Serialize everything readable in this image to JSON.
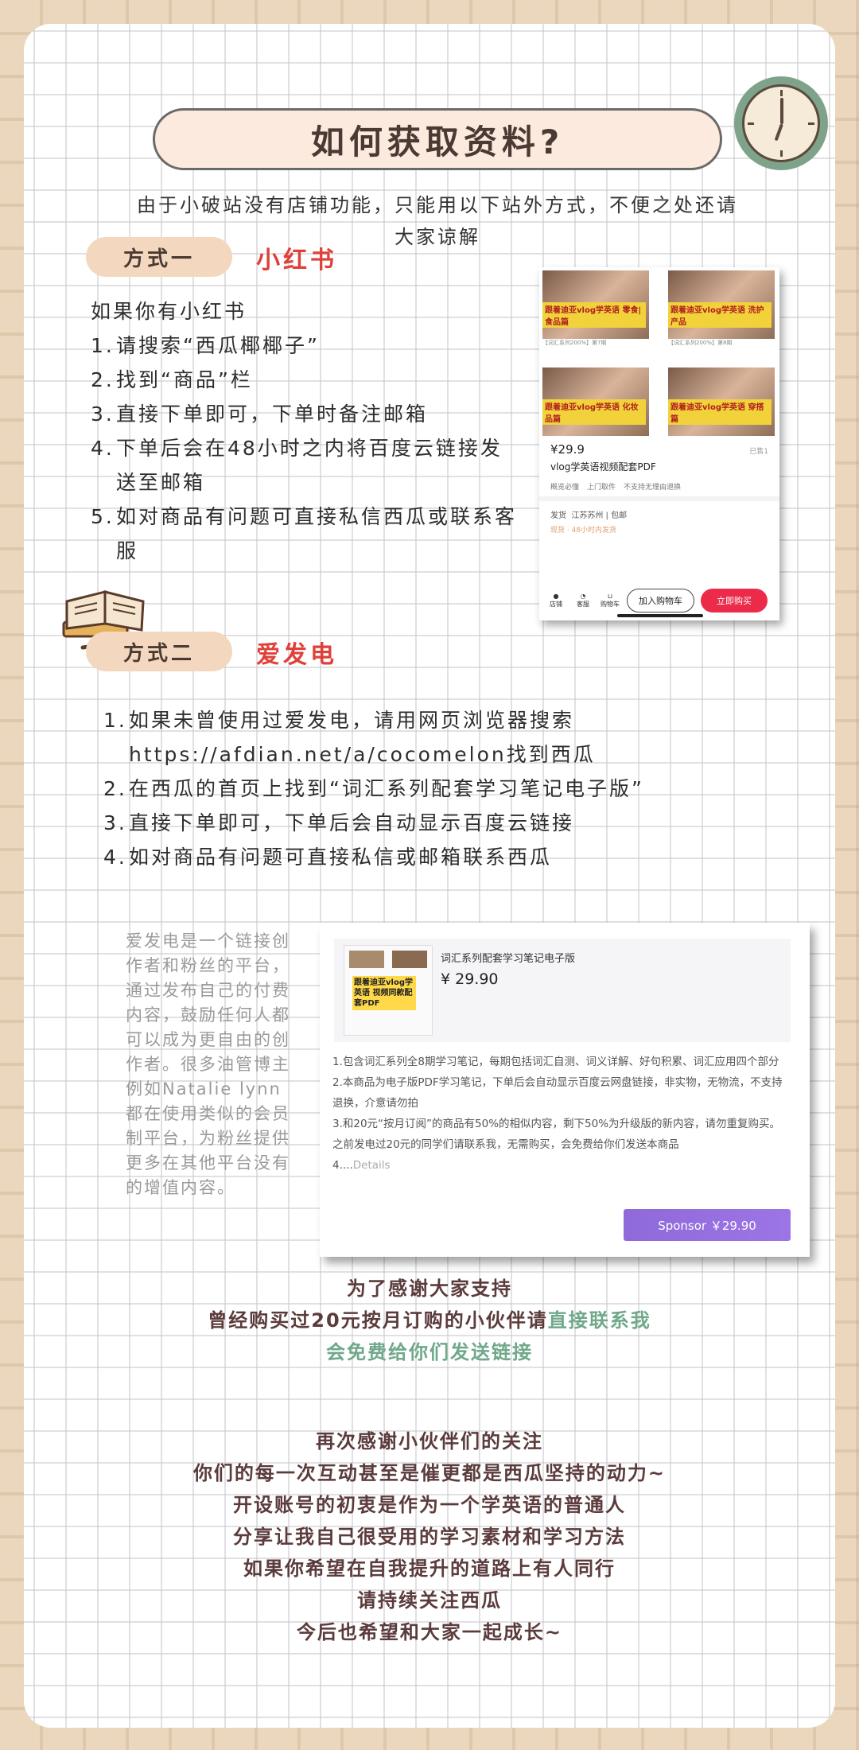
{
  "header": {
    "title": "如何获取资料?",
    "intro": "由于小破站没有店铺功能，只能用以下站外方式，不便之处还请大家谅解"
  },
  "method1": {
    "label": "方式一",
    "platform": "小红书",
    "lead": "如果你有小红书",
    "steps": [
      {
        "num": "1.",
        "text": "请搜索“西瓜椰椰子”"
      },
      {
        "num": "2.",
        "text": "找到“商品”栏"
      },
      {
        "num": "3.",
        "text": "直接下单即可，下单时备注邮箱"
      },
      {
        "num": "4.",
        "text": "下单后会在48小时之内将百度云链接发送至邮箱"
      },
      {
        "num": "5.",
        "text": "如对商品有问题可直接私信西瓜或联系客服"
      }
    ],
    "screenshot": {
      "thumb_captions": [
        "跟着迪亚vlog学英语 零食|食品篇",
        "跟着迪亚vlog学英语 洗护产品",
        "跟着迪亚vlog学英语 化妆品篇",
        "跟着迪亚vlog学英语 穿搭篇"
      ],
      "thumb_subs": [
        "【词汇系列200%】第7期",
        "【词汇系列200%】第8期"
      ],
      "price": "¥29.9",
      "sold": "已售1",
      "product_title": "vlog学英语视频配套PDF",
      "tags": [
        "概览必懂",
        "上门取件",
        "不支持无理由退换"
      ],
      "ship_label": "发货",
      "ship_from": "江苏苏州 | 包邮",
      "ship_note": "现货 · 48小时内发货",
      "nav": [
        "店铺",
        "客服",
        "购物车"
      ],
      "add_cart": "加入购物车",
      "buy_now": "立即购买"
    }
  },
  "method2": {
    "label": "方式二",
    "platform": "爱发电",
    "steps": [
      {
        "num": "1.",
        "text": "如果未曾使用过爱发电，请用网页浏览器搜索https://afdian.net/a/cocomelon找到西瓜"
      },
      {
        "num": "2.",
        "text": "在西瓜的首页上找到“词汇系列配套学习笔记电子版”"
      },
      {
        "num": "3.",
        "text": "直接下单即可，下单后会自动显示百度云链接"
      },
      {
        "num": "4.",
        "text": "如对商品有问题可直接私信或邮箱联系西瓜"
      }
    ],
    "side_note": "爱发电是一个链接创作者和粉丝的平台，通过发布自己的付费内容，鼓励任何人都可以成为更自由的创作者。很多油管博主例如Natalie lynn都在使用类似的会员制平台，为粉丝提供更多在其他平台没有的增值内容。",
    "card": {
      "thumb_label": "跟着迪亚vlog学英语 视频同款配套PDF",
      "title": "词汇系列配套学习笔记电子版",
      "price": "¥ 29.90",
      "desc1": "1.包含词汇系列全8期学习笔记，每期包括词汇自测、词义详解、好句积累、词汇应用四个部分",
      "desc2": "2.本商品为电子版PDF学习笔记，下单后会自动显示百度云网盘链接，非实物，无物流，不支持退换，介意请勿拍",
      "desc3": "3.和20元“按月订阅”的商品有50%的相似内容，剩下50%为升级版的新内容，请勿重复购买。之前发电过20元的同学们请联系我，无需购买，会免费给你们发送本商品",
      "desc4": "4....",
      "details": "Details",
      "sponsor": "Sponsor ￥29.90"
    }
  },
  "thanks": {
    "line1": "为了感谢大家支持",
    "line2a": "曾经购买过20元按月订购的小伙伴请",
    "line2b": "直接联系我",
    "line3": "会免费给你们发送链接",
    "para": [
      "再次感谢小伙伴们的关注",
      "你们的每一次互动甚至是催更都是西瓜坚持的动力~",
      "开设账号的初衷是作为一个学英语的普通人",
      "分享让我自己很受用的学习素材和学习方法",
      "如果你希望在自我提升的道路上有人同行",
      "请持续关注西瓜",
      "今后也希望和大家一起成长~"
    ]
  },
  "colors": {
    "accent_red": "#e0403a",
    "pill": "#f3d8bf",
    "green": "#6fa88a",
    "sponsor_purple": "#8f6ad9"
  }
}
